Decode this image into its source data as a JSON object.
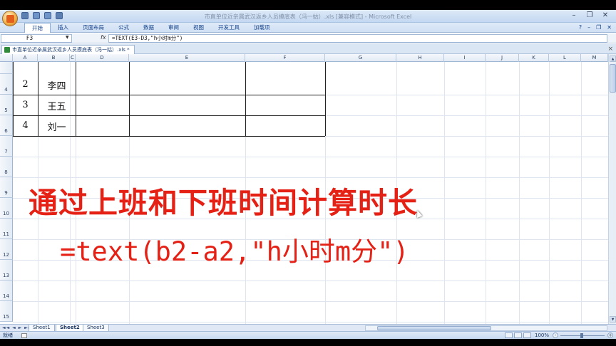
{
  "window": {
    "title": "市直单位近亲属武汉返乡人员摸底表（冯一姑）.xls [兼容模式] - Microsoft Excel",
    "controls": [
      "–",
      "❐",
      "✕"
    ]
  },
  "ribbon": {
    "tabs": [
      "开始",
      "插入",
      "页面布局",
      "公式",
      "数据",
      "审阅",
      "视图",
      "开发工具",
      "加载项"
    ],
    "active_tab": 0,
    "help_icon": "?",
    "right_glyphs": [
      "–",
      "❐",
      "✕"
    ]
  },
  "formula_bar": {
    "name_box": "F3",
    "fx_label": "fx",
    "formula": "=TEXT(E3-D3,\"h小时m分\")"
  },
  "workbook_tab": {
    "label": "市直单位近亲属武汉返乡人员摸底表（冯一姑）.xls *",
    "close": "×"
  },
  "columns": [
    "A",
    "B",
    "C",
    "D",
    "E",
    "F",
    "G",
    "H",
    "I",
    "J",
    "K",
    "L",
    "M"
  ],
  "rows": [
    "4",
    "5",
    "6",
    "7",
    "8",
    "9",
    "10",
    "11",
    "12",
    "13",
    "14",
    "15"
  ],
  "table_rows": [
    {
      "no": "2",
      "name": "李四"
    },
    {
      "no": "3",
      "name": "王五"
    },
    {
      "no": "4",
      "name": "刘一"
    }
  ],
  "overlay": {
    "line1": "通过上班和下班时间计算时长",
    "line2": "=text(b2-a2,\"h小时m分\")",
    "color": "#e52116"
  },
  "sheets": [
    "Sheet1",
    "Sheet2",
    "Sheet3"
  ],
  "active_sheet": 1,
  "sheet_nav": "◄◄ ◄ ► ►►",
  "status": {
    "mode": "就绪",
    "zoom": "100%"
  }
}
